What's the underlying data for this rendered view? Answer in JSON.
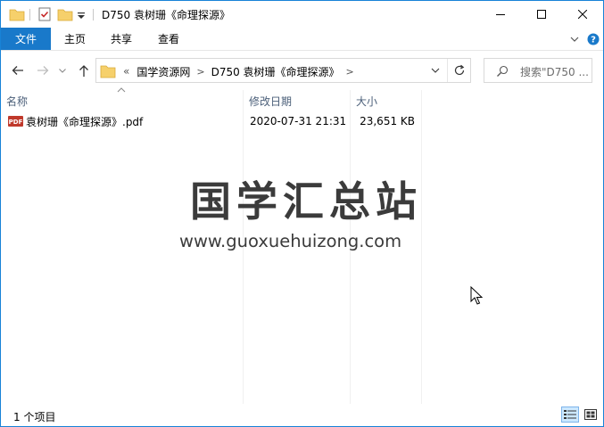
{
  "window": {
    "title": "D750 袁树珊《命理探源》",
    "controls": {
      "minimize": "minimize",
      "maximize": "maximize",
      "close": "close"
    }
  },
  "ribbon": {
    "file_tab": "文件",
    "tabs": [
      "主页",
      "共享",
      "查看"
    ]
  },
  "address": {
    "overflow": "«",
    "crumbs": [
      "国学资源网",
      "D750 袁树珊《命理探源》"
    ]
  },
  "search": {
    "placeholder": "搜索\"D750 ..."
  },
  "columns": {
    "name": "名称",
    "modified": "修改日期",
    "size": "大小"
  },
  "files": [
    {
      "name": "袁树珊《命理探源》.pdf",
      "modified": "2020-07-31 21:31",
      "size": "23,651 KB",
      "icon": "pdf-file-icon",
      "icon_text": "PDF"
    }
  ],
  "watermark": {
    "title": "国学汇总站",
    "url": "www.guoxuehuizong.com"
  },
  "status": {
    "item_count": "1 个项目"
  },
  "colors": {
    "accent": "#1979ca",
    "column_header": "#4c607a",
    "folder": "#f6d06b"
  }
}
